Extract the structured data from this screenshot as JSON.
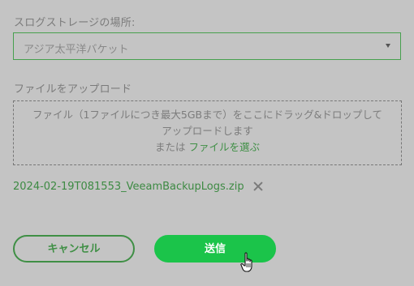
{
  "log_location": {
    "label": "スログストレージの場所:",
    "selected": "アジア太平洋バケット"
  },
  "upload": {
    "label": "ファイルをアップロード",
    "drop_text_line1": "ファイル（1ファイルにつき最大5GBまで）をここにドラッグ&ドロップして",
    "drop_text_line2": "アップロードします",
    "drop_text_or": "または",
    "drop_pick_link": "ファイルを選ぶ"
  },
  "selected_file": {
    "name": "2024-02-19T081553_VeeamBackupLogs.zip"
  },
  "buttons": {
    "cancel": "キャンセル",
    "send": "送信"
  },
  "colors": {
    "background": "#c4c4c4",
    "accent_green": "#3f8f45",
    "send_button": "#1bc44a"
  }
}
